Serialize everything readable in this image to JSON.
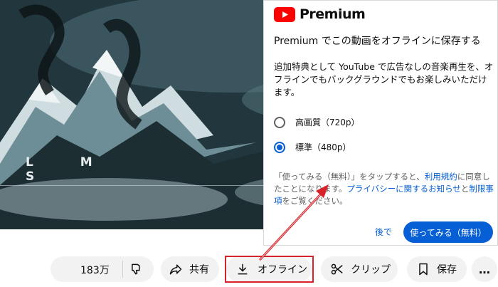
{
  "video": {
    "watermark_letters": "L M S"
  },
  "actions": {
    "like_count": "183万",
    "share_label": "共有",
    "offline_label": "オフライン",
    "clip_label": "クリップ",
    "save_label": "保存",
    "more_label": "…"
  },
  "popup": {
    "brand": "Premium",
    "title": "Premium でこの動画をオフラインに保存する",
    "description": "追加特典として YouTube で広告なしの音楽再生を、オフラインでもバックグラウンドでもお楽しみいただけます。",
    "options": [
      {
        "label": "高画質（720p）",
        "selected": false
      },
      {
        "label": "標準（480p）",
        "selected": true
      }
    ],
    "terms_part1": "「使ってみる（無料）」をタップすると、",
    "terms_link1": "利用規約",
    "terms_part2": "に同意したことになります。",
    "terms_link2": "プライバシーに関するお知らせ",
    "terms_part3": "と",
    "terms_link3": "制限事項",
    "terms_part4": "をご覧ください。",
    "later_label": "後で",
    "try_label": "使ってみる（無料）"
  },
  "colors": {
    "accent": "#065fd4",
    "highlight": "#d7222b",
    "youtube_red": "#ff0000"
  },
  "icons": [
    "youtube-logo-icon",
    "dislike-icon",
    "share-icon",
    "download-icon",
    "scissors-icon",
    "bookmark-icon",
    "more-icon"
  ]
}
